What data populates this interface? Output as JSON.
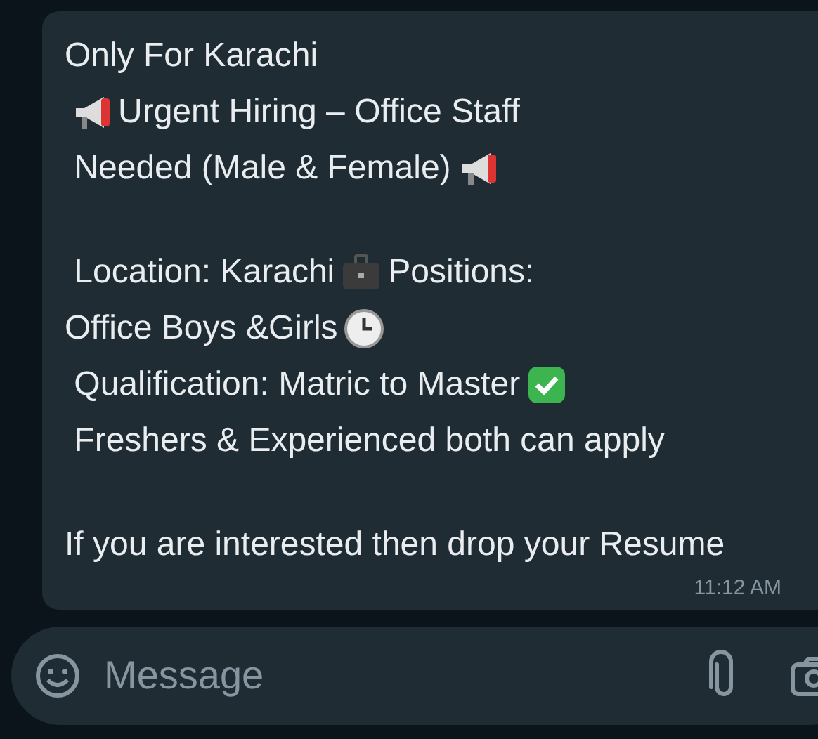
{
  "message": {
    "paragraphs": [
      [
        {
          "parts": [
            "Only For Karachi"
          ]
        },
        {
          "parts": [
            "Urgent Hiring – Office Staff"
          ]
        },
        {
          "parts": [
            " Needed (Male & Female)"
          ]
        }
      ],
      [
        {
          "parts": [
            " Location: Karachi",
            "Positions:"
          ]
        },
        {
          "parts": [
            "Office Boys &Girls"
          ]
        },
        {
          "parts": [
            " Qualification: Matric to Master"
          ]
        },
        {
          "parts": [
            " Freshers & Experienced both can apply"
          ]
        }
      ],
      [
        {
          "parts": [
            "If you are interested then drop your Resume"
          ]
        }
      ]
    ],
    "time": "11:12 AM"
  },
  "composer": {
    "placeholder": "Message"
  }
}
